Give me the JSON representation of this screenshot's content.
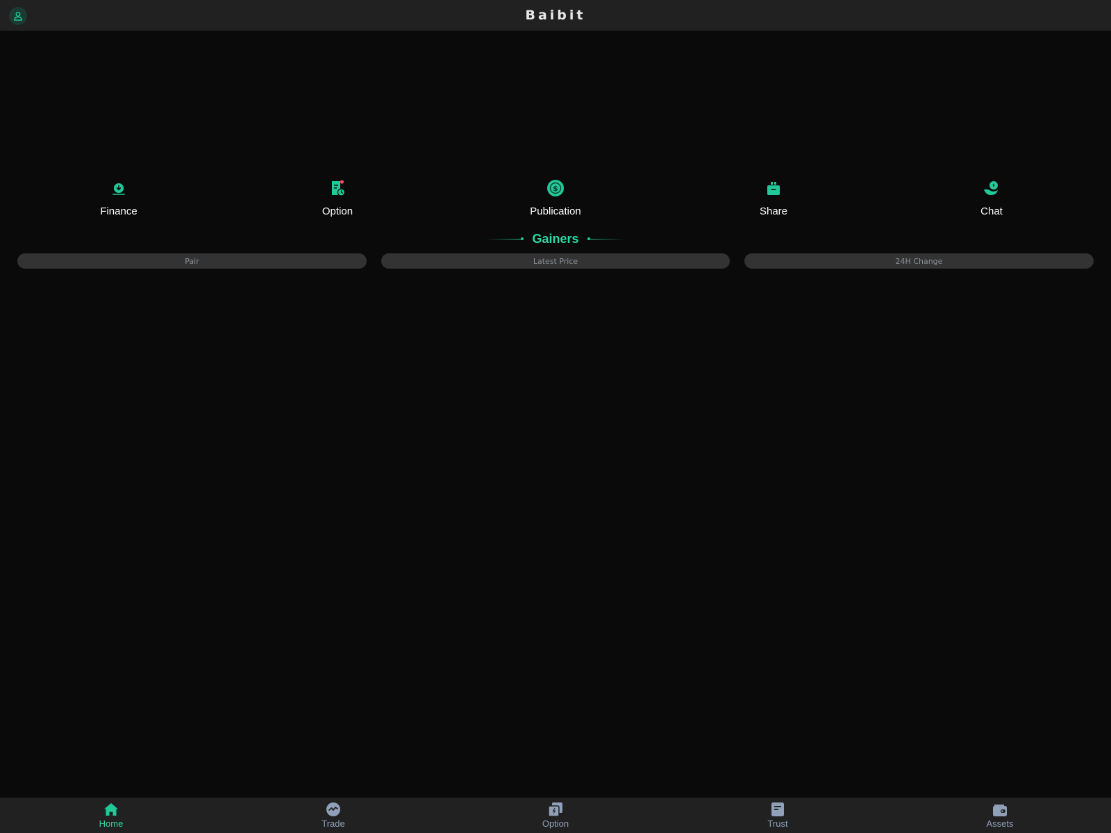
{
  "header": {
    "title": "Baibit",
    "profile_icon": "user-icon"
  },
  "colors": {
    "accent": "#20c997",
    "background": "#0a0a0a",
    "bar": "#212121",
    "inactive_tab": "#8fa0b8"
  },
  "quick_nav": [
    {
      "label": "Finance",
      "icon": "download-cloud-icon"
    },
    {
      "label": "Option",
      "icon": "document-clock-icon"
    },
    {
      "label": "Publication",
      "icon": "dollar-coin-icon"
    },
    {
      "label": "Share",
      "icon": "gift-box-icon"
    },
    {
      "label": "Chat",
      "icon": "hand-coin-icon"
    }
  ],
  "gainers": {
    "title": "Gainers",
    "columns": [
      "Pair",
      "Latest Price",
      "24H Change"
    ]
  },
  "bottom_nav": {
    "active": "Home",
    "tabs": [
      {
        "label": "Home",
        "icon": "home-icon"
      },
      {
        "label": "Trade",
        "icon": "exchange-icon"
      },
      {
        "label": "Option",
        "icon": "flash-copy-icon"
      },
      {
        "label": "Trust",
        "icon": "document-icon"
      },
      {
        "label": "Assets",
        "icon": "wallet-icon"
      }
    ]
  }
}
